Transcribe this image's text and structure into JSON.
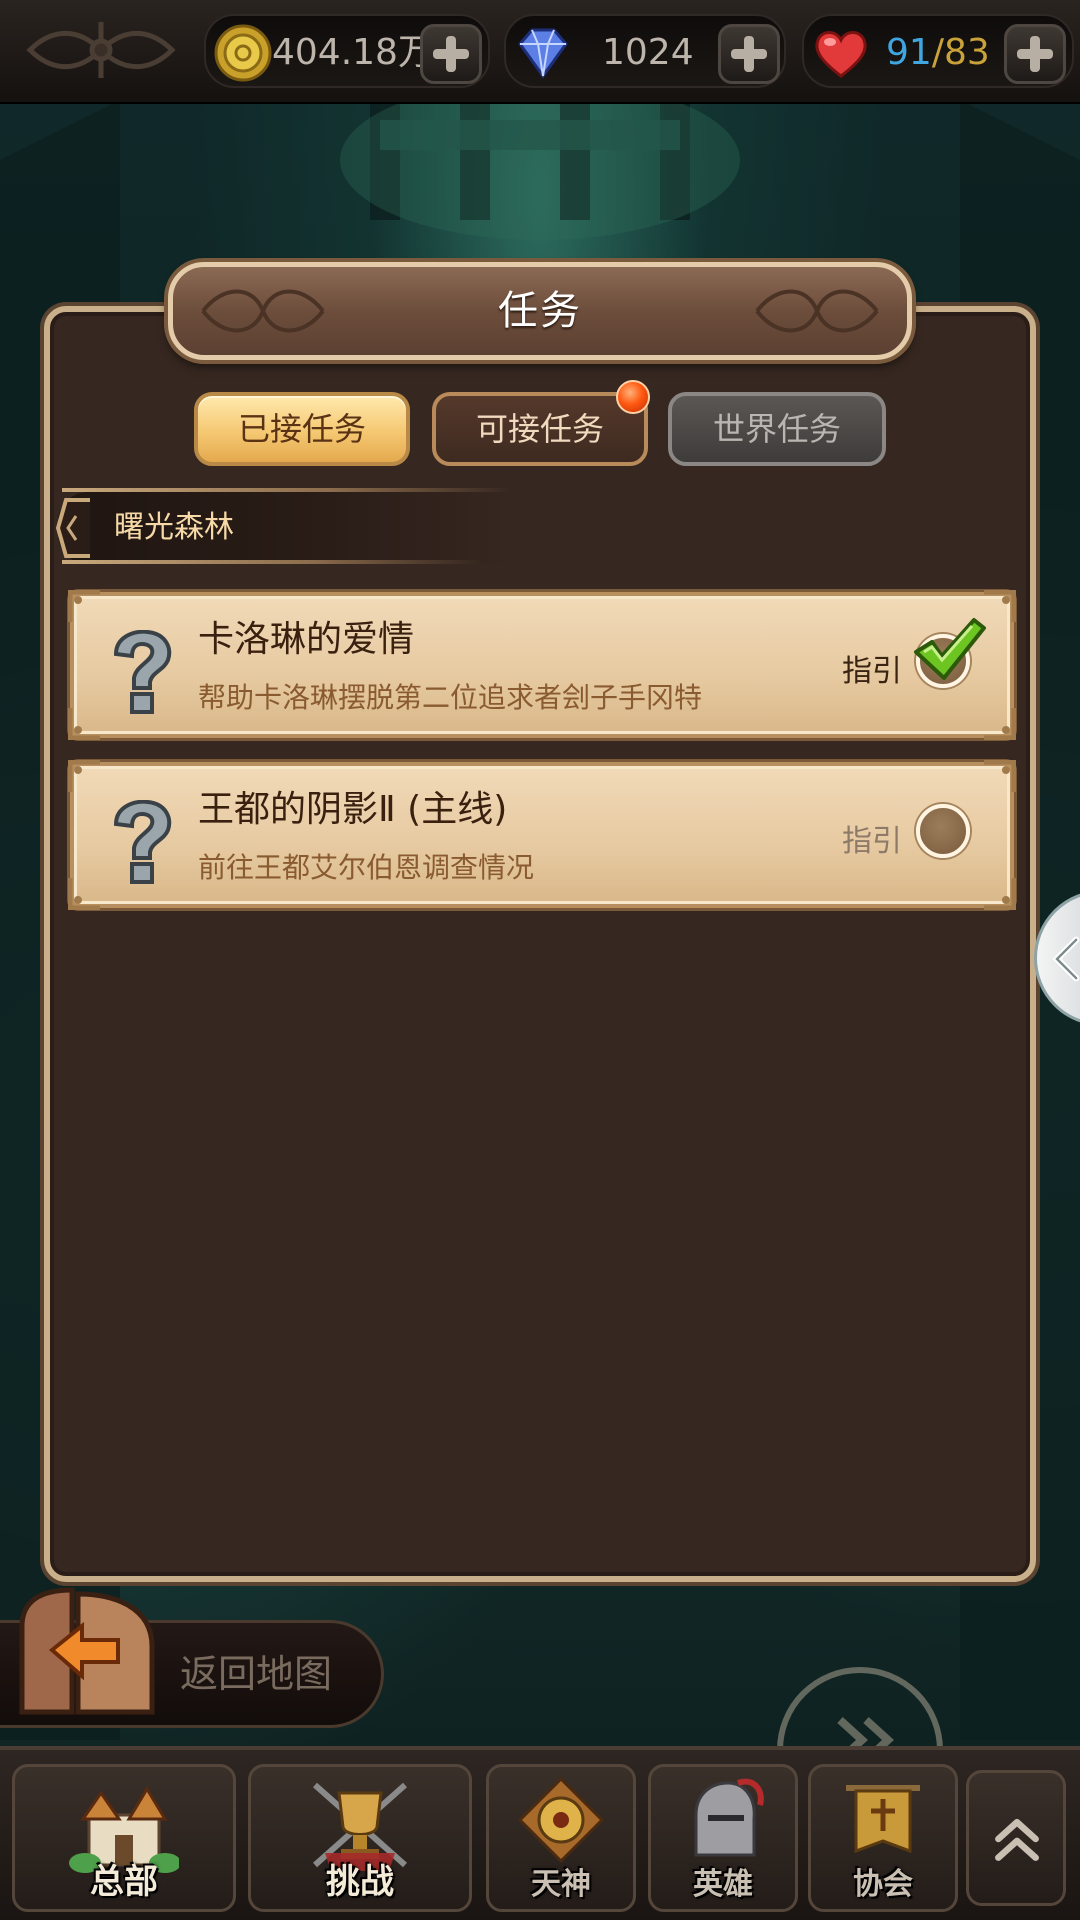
{
  "resources": {
    "gold": {
      "value": "404.18万",
      "icon": "gold-coin-icon"
    },
    "gems": {
      "value": "1024",
      "icon": "diamond-icon"
    },
    "stamina": {
      "current": "91",
      "separator": "/",
      "max": "83",
      "icon": "heart-icon"
    }
  },
  "panel": {
    "title": "任务",
    "tabs": [
      {
        "label": "已接任务",
        "state": "active"
      },
      {
        "label": "可接任务",
        "state": "normal",
        "has_notification": true
      },
      {
        "label": "世界任务",
        "state": "disabled"
      }
    ],
    "region": "曙光森林",
    "quests": [
      {
        "title": "卡洛琳的爱情",
        "description": "帮助卡洛琳摆脱第二位追求者刽子手冈特",
        "guide_label": "指引",
        "guide_checked": true,
        "icon": "question-mark-icon"
      },
      {
        "title": "王都的阴影Ⅱ (主线)",
        "description": "前往王都艾尔伯恩调查情况",
        "guide_label": "指引",
        "guide_checked": false,
        "icon": "question-mark-icon"
      }
    ]
  },
  "back_to_map": {
    "label": "返回地图"
  },
  "nav": [
    {
      "label": "总部",
      "icon": "castle-icon"
    },
    {
      "label": "挑战",
      "icon": "trophy-icon"
    },
    {
      "label": "天神",
      "icon": "god-emblem-icon"
    },
    {
      "label": "英雄",
      "icon": "helmet-icon"
    },
    {
      "label": "协会",
      "icon": "banner-icon"
    }
  ],
  "colors": {
    "panel_bg": "#362720",
    "card_bg": "#e6c9a0",
    "tab_active": "#f5c872",
    "stamina_current": "#3fa6e0",
    "stamina_max": "#c9a23a"
  }
}
